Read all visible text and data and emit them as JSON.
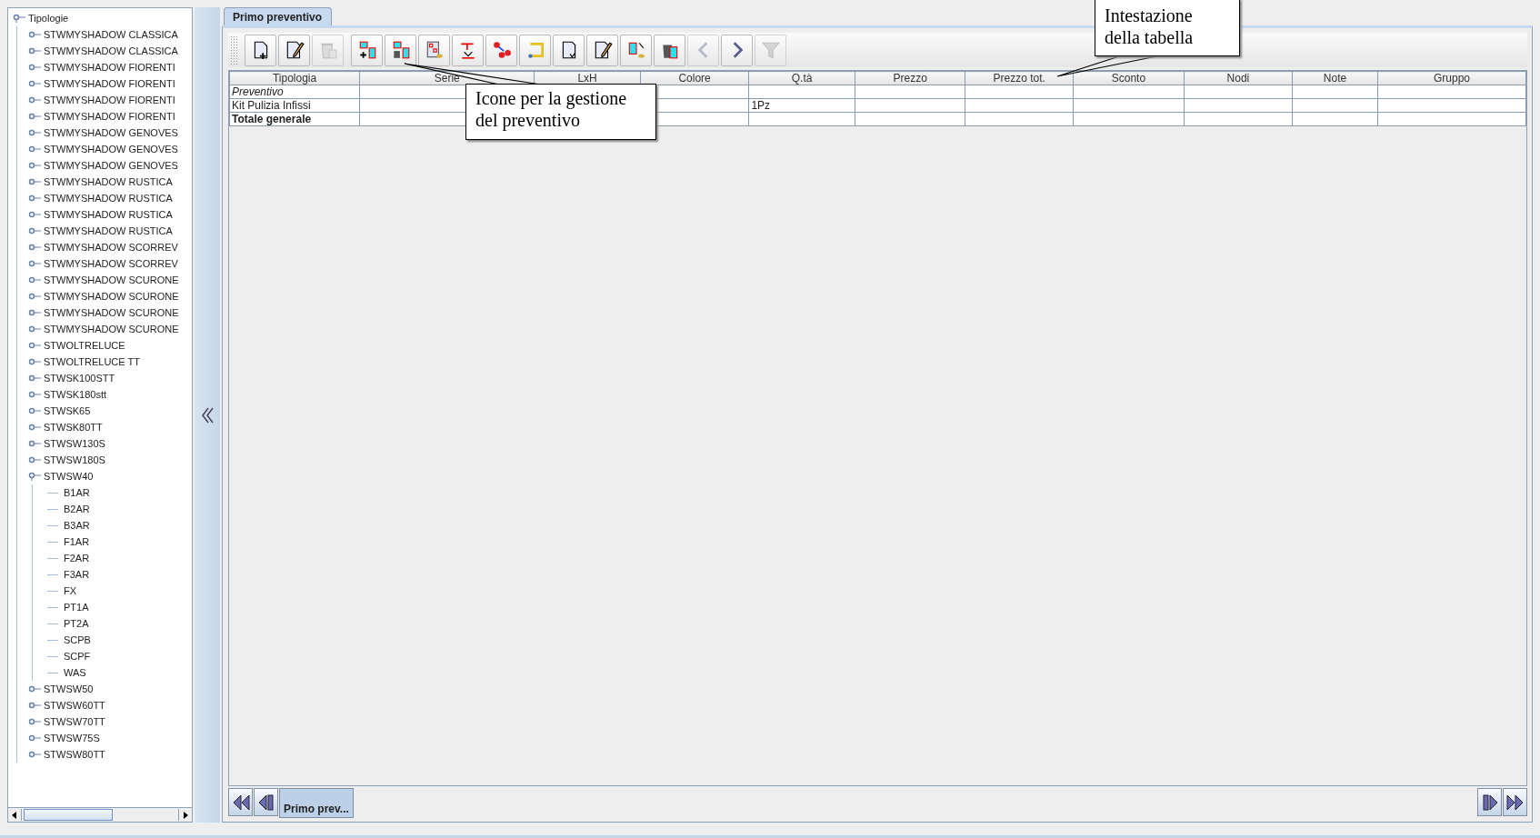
{
  "tree": {
    "label": "Tipologie",
    "expanded": true,
    "children": [
      {
        "label": "STWMYSHADOW CLASSICA",
        "expanded": false
      },
      {
        "label": "STWMYSHADOW CLASSICA",
        "expanded": false
      },
      {
        "label": "STWMYSHADOW FIORENTI",
        "expanded": false
      },
      {
        "label": "STWMYSHADOW FIORENTI",
        "expanded": false
      },
      {
        "label": "STWMYSHADOW FIORENTI",
        "expanded": false
      },
      {
        "label": "STWMYSHADOW FIORENTI",
        "expanded": false
      },
      {
        "label": "STWMYSHADOW GENOVES",
        "expanded": false
      },
      {
        "label": "STWMYSHADOW GENOVES",
        "expanded": false
      },
      {
        "label": "STWMYSHADOW GENOVES",
        "expanded": false
      },
      {
        "label": "STWMYSHADOW RUSTICA",
        "expanded": false
      },
      {
        "label": "STWMYSHADOW RUSTICA",
        "expanded": false
      },
      {
        "label": "STWMYSHADOW RUSTICA",
        "expanded": false
      },
      {
        "label": "STWMYSHADOW RUSTICA",
        "expanded": false
      },
      {
        "label": "STWMYSHADOW SCORREV",
        "expanded": false
      },
      {
        "label": "STWMYSHADOW SCORREV",
        "expanded": false
      },
      {
        "label": "STWMYSHADOW SCURONE",
        "expanded": false
      },
      {
        "label": "STWMYSHADOW SCURONE",
        "expanded": false
      },
      {
        "label": "STWMYSHADOW SCURONE",
        "expanded": false
      },
      {
        "label": "STWMYSHADOW SCURONE",
        "expanded": false
      },
      {
        "label": "STWOLTRELUCE",
        "expanded": false
      },
      {
        "label": "STWOLTRELUCE TT",
        "expanded": false
      },
      {
        "label": "STWSK100STT",
        "expanded": false
      },
      {
        "label": "STWSK180stt",
        "expanded": false
      },
      {
        "label": "STWSK65",
        "expanded": false
      },
      {
        "label": "STWSK80TT",
        "expanded": false
      },
      {
        "label": "STWSW130S",
        "expanded": false
      },
      {
        "label": "STWSW180S",
        "expanded": false
      },
      {
        "label": "STWSW40",
        "expanded": true,
        "children": [
          {
            "label": "B1AR"
          },
          {
            "label": "B2AR"
          },
          {
            "label": "B3AR"
          },
          {
            "label": "F1AR"
          },
          {
            "label": "F2AR"
          },
          {
            "label": "F3AR"
          },
          {
            "label": "FX"
          },
          {
            "label": "PT1A"
          },
          {
            "label": "PT2A"
          },
          {
            "label": "SCPB"
          },
          {
            "label": "SCPF"
          },
          {
            "label": "WAS"
          }
        ]
      },
      {
        "label": "STWSW50",
        "expanded": false
      },
      {
        "label": "STWSW60TT",
        "expanded": false
      },
      {
        "label": "STWSW70TT",
        "expanded": false
      },
      {
        "label": "STWSW75S",
        "expanded": false
      },
      {
        "label": "STWSW80TT",
        "expanded": false
      }
    ]
  },
  "tabs": [
    {
      "label": "Primo preventivo",
      "selected": true
    }
  ],
  "toolbar": {
    "groups": [
      {
        "buttons": [
          {
            "disabled": false
          },
          {
            "disabled": false
          },
          {
            "disabled": true
          }
        ]
      },
      {
        "buttons": [
          {
            "disabled": false
          },
          {
            "disabled": false
          },
          {
            "disabled": false
          },
          {
            "disabled": false
          },
          {
            "disabled": false
          },
          {
            "disabled": false
          },
          {
            "disabled": false
          },
          {
            "disabled": false
          },
          {
            "disabled": false
          },
          {
            "disabled": false
          },
          {
            "disabled": true
          },
          {
            "disabled": false
          },
          {
            "disabled": true
          }
        ]
      }
    ]
  },
  "table": {
    "columns": [
      "Tipologia",
      "Serie",
      "LxH",
      "Colore",
      "Q.tà",
      "Prezzo",
      "Prezzo tot.",
      "Sconto",
      "Nodi",
      "Note",
      "Gruppo"
    ],
    "rows": [
      {
        "kind": "section",
        "tipologia": "Preventivo"
      },
      {
        "kind": "item",
        "tipologia": "Kit Pulizia Infissi",
        "q_ta": "1Pz"
      },
      {
        "kind": "total",
        "tipologia": "Totale generale"
      }
    ]
  },
  "bottom_tabs": [
    {
      "label": "Primo prev...",
      "selected": true
    }
  ],
  "callouts": [
    {
      "text": "Icone per la gestione del preventivo"
    },
    {
      "text": "Intestazione della tabella"
    }
  ]
}
